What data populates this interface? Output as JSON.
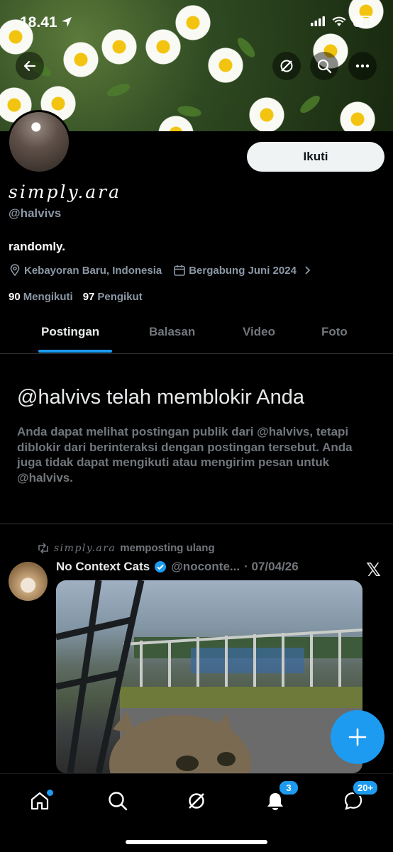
{
  "status_bar": {
    "time": "18.41"
  },
  "profile": {
    "display_name": "simply.ara",
    "handle": "@halvivs",
    "bio": "randomly.",
    "location": "Kebayoran Baru, Indonesia",
    "joined": "Bergabung Juni 2024",
    "following_count": "90",
    "following_label": "Mengikuti",
    "followers_count": "97",
    "followers_label": "Pengikut",
    "follow_button": "Ikuti"
  },
  "tabs": [
    {
      "label": "Postingan",
      "active": true
    },
    {
      "label": "Balasan",
      "active": false
    },
    {
      "label": "Video",
      "active": false
    },
    {
      "label": "Foto",
      "active": false
    }
  ],
  "blocked": {
    "title": "@halvivs telah memblokir Anda",
    "body": "Anda dapat melihat postingan publik dari @halvivs, tetapi diblokir dari berinteraksi dengan postingan tersebut. Anda juga tidak dapat mengikuti atau mengirim pesan untuk @halvivs."
  },
  "post": {
    "repost_by": "simply.ara",
    "repost_suffix": "memposting ulang",
    "author": "No Context Cats",
    "author_handle": "@noconte...",
    "date": "· 07/04/26"
  },
  "nav": {
    "notifications_badge": "3",
    "messages_badge": "20+"
  },
  "colors": {
    "accent": "#1d9bf0",
    "secondary_text": "#71767b",
    "background": "#000000"
  }
}
